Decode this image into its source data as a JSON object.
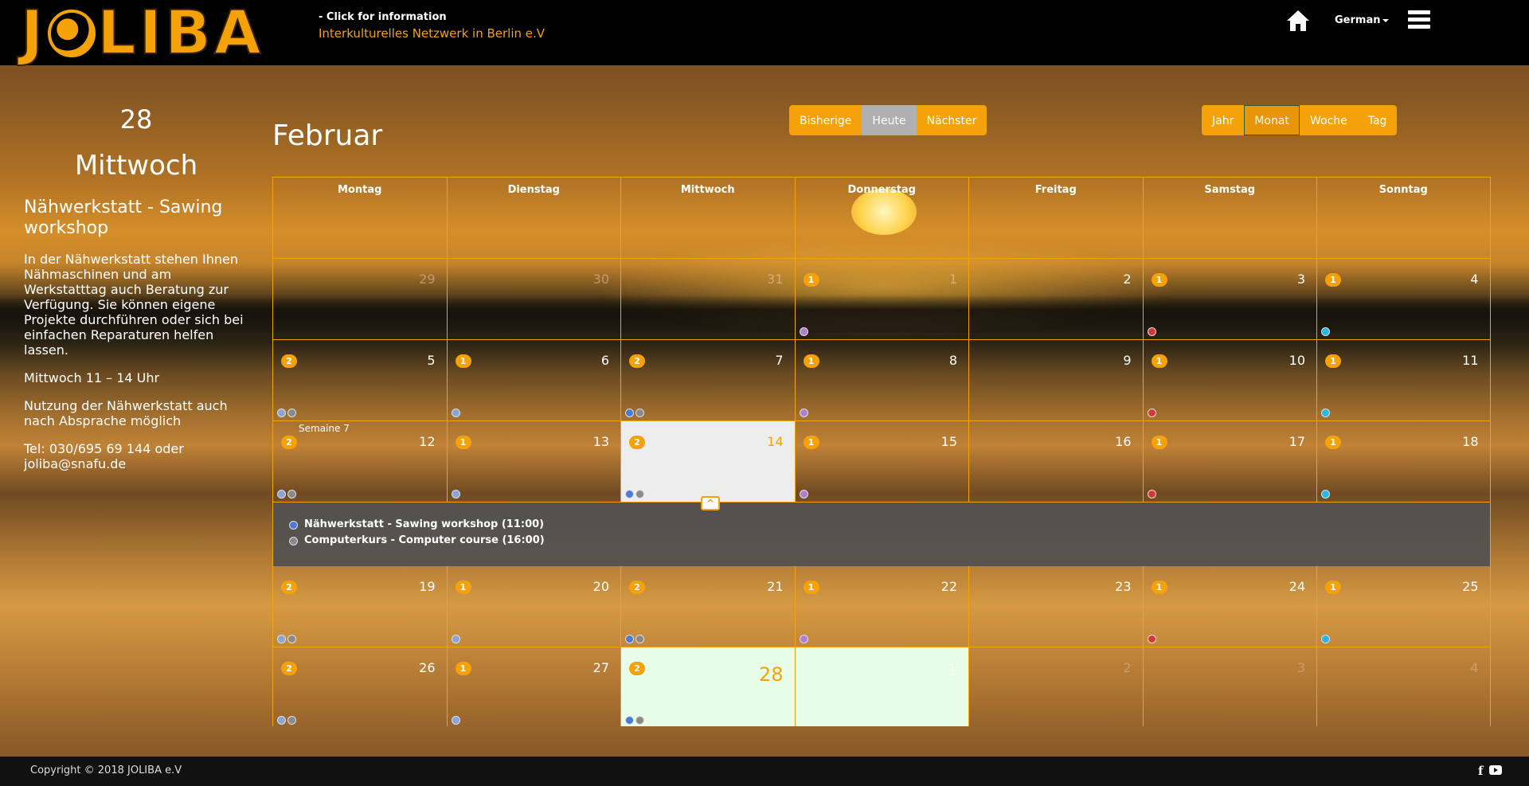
{
  "header": {
    "logo_text": "JOLIBA",
    "click_info": "- Click for information",
    "tagline": "Interkulturelles Netzwerk in Berlin e.V",
    "language": "German",
    "icons": [
      "home-icon",
      "hamburger-menu-icon",
      "globe-logo-icon"
    ]
  },
  "sidebar": {
    "day": "28",
    "weekday": "Mittwoch",
    "event_title": "Nähwerkstatt - Sawing workshop",
    "event_description": "In der Nähwerkstatt stehen Ihnen Nähmaschinen und am Werkstatttag auch Beratung zur Verfügung. Sie können eigene Projekte durchführen oder sich bei einfachen Reparaturen helfen lassen.",
    "event_time": "Mittwoch 11 – 14 Uhr",
    "event_note": "Nutzung der Nähwerkstatt auch nach Absprache möglich",
    "event_contact": "Tel: 030/695 69 144 oder joliba@snafu.de"
  },
  "calendar": {
    "month": "Februar",
    "nav": {
      "prev": "Bisherige",
      "today": "Heute",
      "next": "Nächster"
    },
    "views": {
      "year": "Jahr",
      "month": "Monat",
      "week": "Woche",
      "day": "Tag",
      "active": "Monat"
    },
    "weekdays": [
      "Montag",
      "Dienstag",
      "Mittwoch",
      "Donnerstag",
      "Freitag",
      "Samstag",
      "Sonntag"
    ],
    "week_label": "Semaine 7",
    "colors": {
      "accent": "#f5a20a",
      "blue": "#4a7bd6",
      "gray": "#8a8a8a",
      "lightblue": "#8aa4d8",
      "purple": "#b07fd0",
      "red": "#d23a3a",
      "cyan": "#2ab6e6"
    },
    "weeks": [
      [
        {
          "n": "29",
          "other": true
        },
        {
          "n": "30",
          "other": true
        },
        {
          "n": "31",
          "other": true
        },
        {
          "n": "1",
          "other": true,
          "badge": "1",
          "dots": [
            "purple"
          ]
        },
        {
          "n": "2"
        },
        {
          "n": "3",
          "badge": "1",
          "dots": [
            "red"
          ]
        },
        {
          "n": "4",
          "badge": "1",
          "dots": [
            "cyan"
          ]
        }
      ],
      [
        {
          "n": "5",
          "badge": "2",
          "dots": [
            "lightblue",
            "gray"
          ]
        },
        {
          "n": "6",
          "badge": "1",
          "dots": [
            "lightblue"
          ]
        },
        {
          "n": "7",
          "badge": "2",
          "dots": [
            "blue",
            "gray"
          ]
        },
        {
          "n": "8",
          "badge": "1",
          "dots": [
            "purple"
          ]
        },
        {
          "n": "9"
        },
        {
          "n": "10",
          "badge": "1",
          "dots": [
            "red"
          ]
        },
        {
          "n": "11",
          "badge": "1",
          "dots": [
            "cyan"
          ]
        }
      ],
      [
        {
          "n": "12",
          "badge": "2",
          "dots": [
            "lightblue",
            "gray"
          ],
          "week_label": true
        },
        {
          "n": "13",
          "badge": "1",
          "dots": [
            "lightblue"
          ]
        },
        {
          "n": "14",
          "badge": "2",
          "dots": [
            "blue",
            "gray"
          ],
          "selected": true
        },
        {
          "n": "15",
          "badge": "1",
          "dots": [
            "purple"
          ]
        },
        {
          "n": "16"
        },
        {
          "n": "17",
          "badge": "1",
          "dots": [
            "red"
          ]
        },
        {
          "n": "18",
          "badge": "1",
          "dots": [
            "cyan"
          ]
        }
      ],
      [
        {
          "n": "19",
          "badge": "2",
          "dots": [
            "lightblue",
            "gray"
          ]
        },
        {
          "n": "20",
          "badge": "1",
          "dots": [
            "lightblue"
          ]
        },
        {
          "n": "21",
          "badge": "2",
          "dots": [
            "blue",
            "gray"
          ]
        },
        {
          "n": "22",
          "badge": "1",
          "dots": [
            "purple"
          ]
        },
        {
          "n": "23"
        },
        {
          "n": "24",
          "badge": "1",
          "dots": [
            "red"
          ]
        },
        {
          "n": "25",
          "badge": "1",
          "dots": [
            "cyan"
          ]
        }
      ],
      [
        {
          "n": "26",
          "badge": "2",
          "dots": [
            "lightblue",
            "gray"
          ]
        },
        {
          "n": "27",
          "badge": "1",
          "dots": [
            "lightblue"
          ]
        },
        {
          "n": "28",
          "badge": "2",
          "dots": [
            "blue",
            "gray"
          ],
          "today": true
        },
        {
          "n": "1",
          "other": true,
          "fade": true
        },
        {
          "n": "2",
          "other": true,
          "light": true
        },
        {
          "n": "3",
          "other": true,
          "light": true
        },
        {
          "n": "4",
          "other": true,
          "light": true
        }
      ]
    ],
    "expanded_events": [
      {
        "label": "Nähwerkstatt - Sawing workshop (11:00)",
        "color": "blue"
      },
      {
        "label": "Computerkurs - Computer course (16:00)",
        "color": "gray"
      }
    ]
  },
  "footer": {
    "copyright": "Copyright © 2018 JOLIBA e.V",
    "social_icons": [
      "facebook-icon",
      "youtube-icon"
    ]
  }
}
